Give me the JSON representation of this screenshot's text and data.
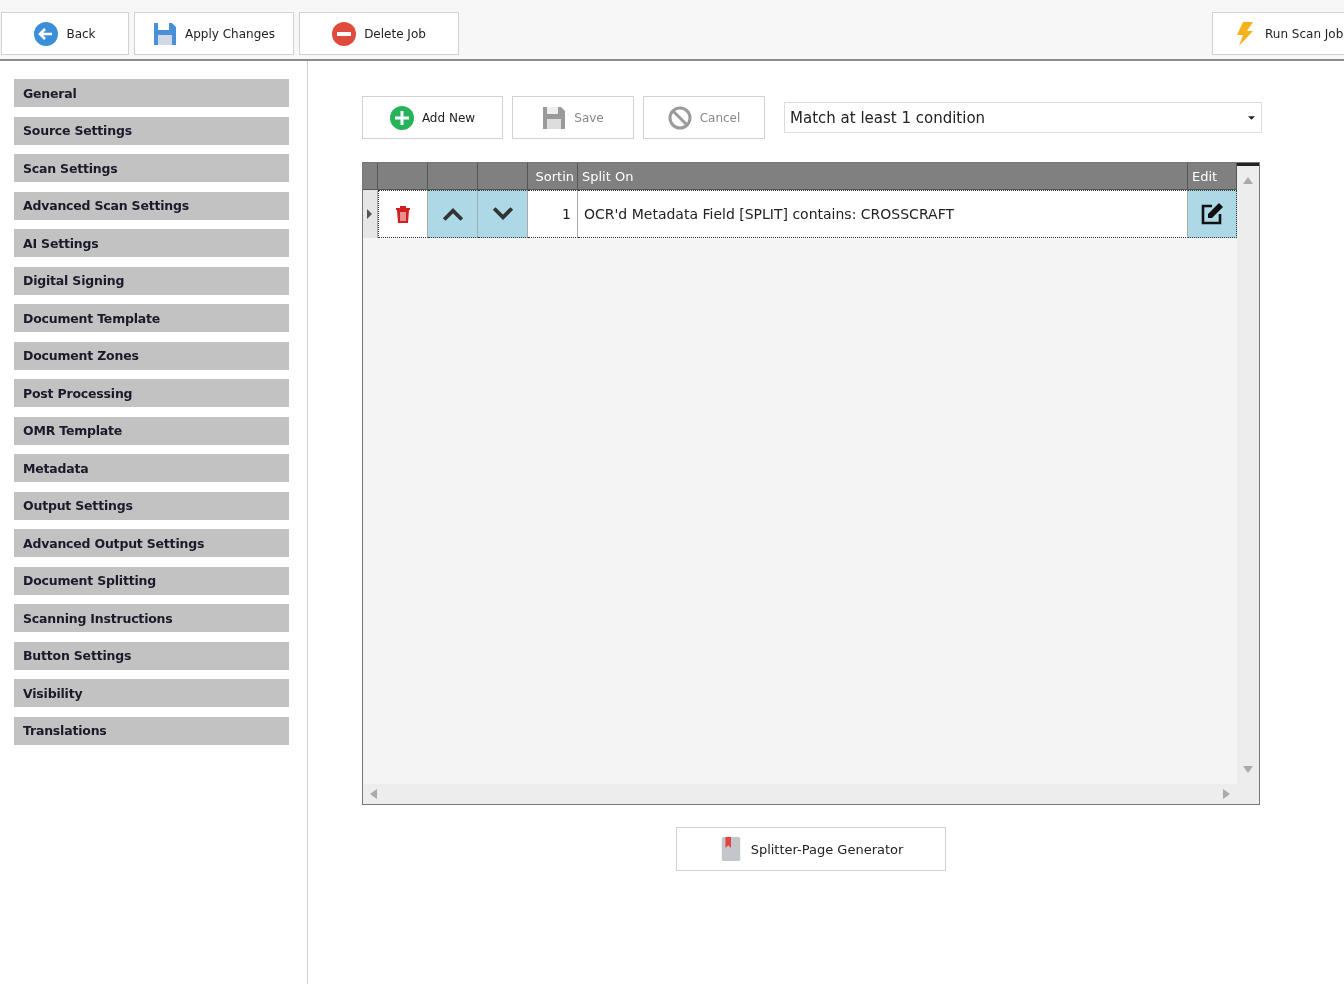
{
  "toolbar": {
    "left": [
      {
        "label": "Back",
        "kind": "back"
      },
      {
        "label": "Apply Changes",
        "kind": "save"
      },
      {
        "label": "Delete Job",
        "kind": "delete"
      }
    ],
    "right": [
      {
        "label": "Run Scan Job",
        "kind": "run"
      }
    ]
  },
  "sidebar": {
    "items": [
      {
        "label": "General"
      },
      {
        "label": "Source Settings"
      },
      {
        "label": "Scan Settings"
      },
      {
        "label": "Advanced Scan Settings"
      },
      {
        "label": "AI Settings"
      },
      {
        "label": "Digital Signing"
      },
      {
        "label": "Document Template"
      },
      {
        "label": "Document Zones"
      },
      {
        "label": "Post Processing"
      },
      {
        "label": "OMR Template"
      },
      {
        "label": "Metadata"
      },
      {
        "label": "Output Settings"
      },
      {
        "label": "Advanced Output Settings"
      },
      {
        "label": "Document Splitting"
      },
      {
        "label": "Scanning Instructions"
      },
      {
        "label": "Button Settings"
      },
      {
        "label": "Visibility"
      },
      {
        "label": "Translations"
      }
    ]
  },
  "actions": [
    {
      "label": "Add New",
      "kind": "add",
      "disabled": false
    },
    {
      "label": "Save",
      "kind": "save",
      "disabled": true
    },
    {
      "label": "Cancel",
      "kind": "cancel",
      "disabled": true
    }
  ],
  "match_dropdown": {
    "value": "Match at least 1 condition"
  },
  "grid": {
    "columns": [
      {
        "label": "Sortin"
      },
      {
        "label": "Split On"
      },
      {
        "label": "Edit"
      }
    ],
    "rows": [
      {
        "sort": "1",
        "split_on": "OCR'd Metadata Field [SPLIT] contains: CROSSCRAFT",
        "selected": true
      }
    ]
  },
  "footer_button": {
    "label": "Splitter-Page Generator"
  }
}
